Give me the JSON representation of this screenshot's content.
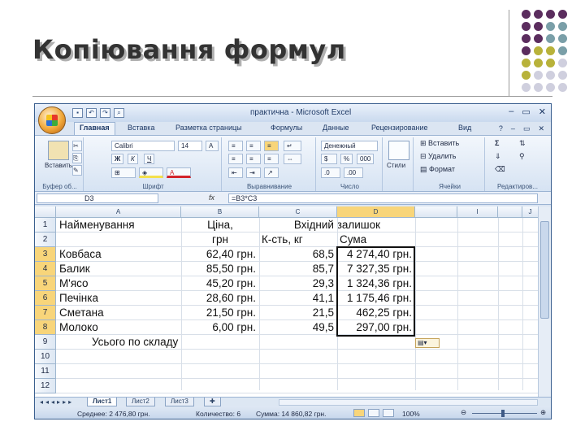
{
  "slide": {
    "title": "Копіювання формул",
    "dot_colors": [
      "#5b2d5e",
      "#7a9fa8",
      "#b8b23a",
      "#cfcfde"
    ]
  },
  "excel": {
    "window_title": "практична - Microsoft Excel",
    "window_buttons": [
      "–",
      "▭",
      "✕"
    ],
    "tabs": [
      "Главная",
      "Вставка",
      "Разметка страницы",
      "Формулы",
      "Данные",
      "Рецензирование",
      "Вид"
    ],
    "ribbon": {
      "clipboard": {
        "paste": "Вставить",
        "label": "Буфер об..."
      },
      "font": {
        "name": "Calibri",
        "size": "14",
        "bold": "Ж",
        "italic": "К",
        "underline": "Ч",
        "label": "Шрифт"
      },
      "alignment": {
        "label": "Выравнивание"
      },
      "number": {
        "format": "Денежный",
        "percent": "%",
        "thousands": "000",
        "label": "Число"
      },
      "styles": {
        "button": "Стили",
        "label": ""
      },
      "cells": {
        "insert": "Вставить",
        "delete": "Удалить",
        "format": "Формат",
        "label": "Ячейки"
      },
      "editing": {
        "sum": "Σ",
        "label": "Редактиров..."
      }
    },
    "formula_bar": {
      "name_box": "D3",
      "fx": "fx",
      "formula": "=B3*C3"
    },
    "columns": [
      "A",
      "B",
      "C",
      "D",
      "",
      "I",
      "",
      "J"
    ],
    "rows": [
      "1",
      "2",
      "3",
      "4",
      "5",
      "6",
      "7",
      "8",
      "9",
      "10",
      "11",
      "12"
    ],
    "selected_rows": [
      "3",
      "4",
      "5",
      "6",
      "7",
      "8"
    ],
    "cells": {
      "a1": "Найменування",
      "b1": "Ціна,",
      "c1": "Вхідний залишок",
      "b2": "грн",
      "c2": "К-сть, кг",
      "d2": "Сума",
      "data": [
        {
          "name": "Ковбаса",
          "price": "62,40 грн.",
          "qty": "68,5",
          "sum": "4 274,40 грн."
        },
        {
          "name": "Балик",
          "price": "85,50 грн.",
          "qty": "85,7",
          "sum": "7 327,35 грн."
        },
        {
          "name": "М'ясо",
          "price": "45,20 грн.",
          "qty": "29,3",
          "sum": "1 324,36 грн."
        },
        {
          "name": "Печінка",
          "price": "28,60 грн.",
          "qty": "41,1",
          "sum": "1 175,46 грн."
        },
        {
          "name": "Сметана",
          "price": "21,50 грн.",
          "qty": "21,5",
          "sum": "462,25 грн."
        },
        {
          "name": "Молоко",
          "price": "6,00 грн.",
          "qty": "49,5",
          "sum": "297,00 грн."
        }
      ],
      "a9": "Усього по складу"
    },
    "sheets": [
      "Лист1",
      "Лист2",
      "Лист3"
    ],
    "status": {
      "average": "Среднее: 2 476,80 грн.",
      "count": "Количество: 6",
      "sum": "Сумма: 14 860,82 грн.",
      "zoom": "100%"
    }
  }
}
